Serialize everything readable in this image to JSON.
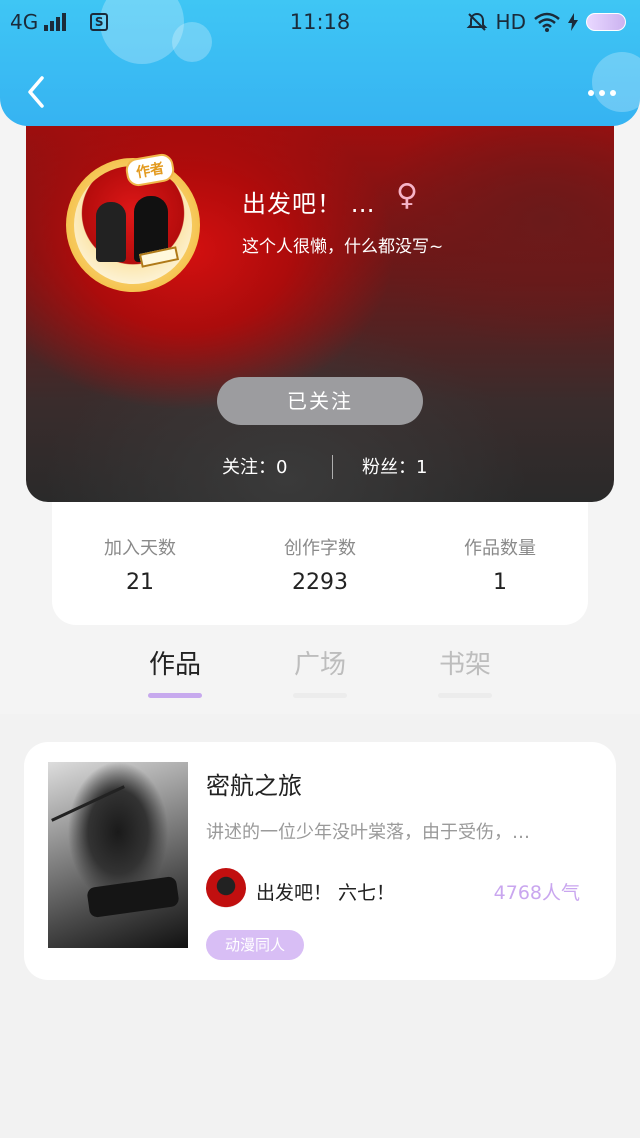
{
  "status_bar": {
    "network": "4G",
    "time": "11:18",
    "hd": "HD",
    "s_icon_label": "S"
  },
  "profile": {
    "author_tag": "作者",
    "username": "出发吧！ …",
    "gender_symbol": "♀",
    "bio": "这个人很懒，什么都没写~",
    "follow_button": "已关注",
    "following": "关注：0",
    "fans": "粉丝：1"
  },
  "stats": [
    {
      "label": "加入天数",
      "value": "21"
    },
    {
      "label": "创作字数",
      "value": "2293"
    },
    {
      "label": "作品数量",
      "value": "1"
    }
  ],
  "tabs": [
    {
      "label": "作品",
      "active": true
    },
    {
      "label": "广场",
      "active": false
    },
    {
      "label": "书架",
      "active": false
    }
  ],
  "works": [
    {
      "title": "密航之旅",
      "description": "讲述的一位少年没叶棠落，由于受伤，…",
      "author": "出发吧！ 六七！",
      "popularity": "4768人气",
      "tag": "动漫同人"
    }
  ],
  "colors": {
    "header": "#36b3f2",
    "accent_purple": "#c9a6ef",
    "follow_button_bg": "#9c9c9f"
  },
  "icons": [
    "back-icon",
    "more-icon",
    "signal-icon",
    "wifi-icon",
    "mute-icon",
    "battery-icon",
    "gender-female-icon"
  ]
}
